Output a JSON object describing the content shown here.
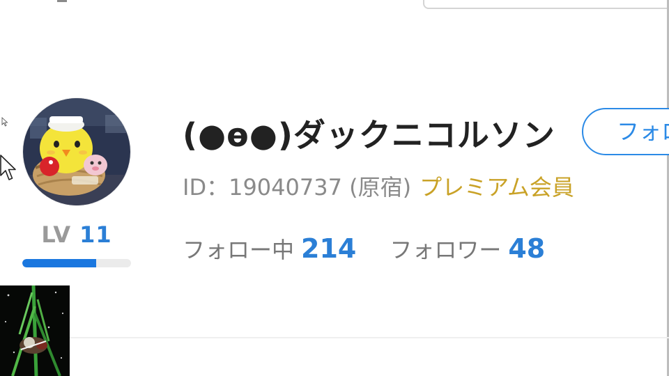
{
  "profile": {
    "username": "(●ө●)ダックニコルソン",
    "id_line": "ID：19040737 (原宿)",
    "premium_label": "プレミアム会員",
    "follow_button_label": "フォロー",
    "level_label": "LV",
    "level_value": "11",
    "level_progress": 0.68
  },
  "stats": {
    "following_label": "フォロー中",
    "following_count": "214",
    "followers_label": "フォロワー",
    "followers_count": "48"
  },
  "colors": {
    "accent": "#2b7fd6",
    "premium": "#c9a227",
    "progress_fill": "#1a77df"
  },
  "icons": {
    "avatar": "chick-plush-avatar",
    "cursor": "mouse-pointer-icon"
  }
}
